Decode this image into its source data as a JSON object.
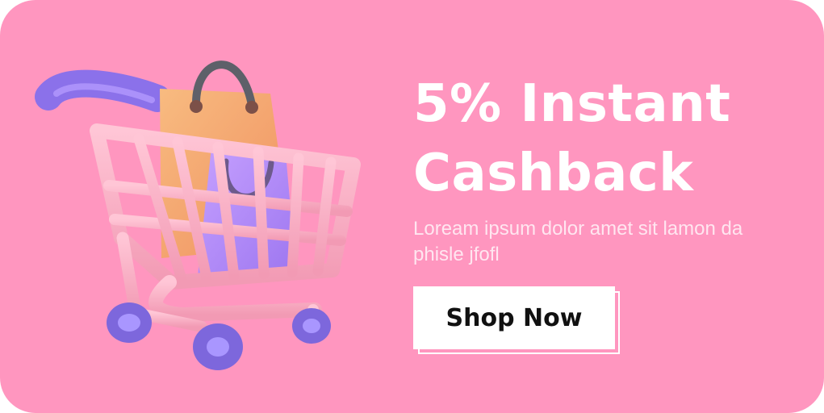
{
  "banner": {
    "headline_line1": "5% Instant",
    "headline_line2": "Cashback",
    "subtext": "Loream ipsum dolor amet sit lamon da phisle jfofl",
    "cta_label": "Shop Now"
  },
  "colors": {
    "background": "#ff96bf",
    "cart_pink": "#f7a6bd",
    "cart_handle": "#9b7cf0",
    "wheel": "#8f78e8",
    "bag_orange": "#f3a56c",
    "bag_purple": "#b28cf5"
  },
  "illustration": {
    "icon": "shopping-cart-icon"
  }
}
